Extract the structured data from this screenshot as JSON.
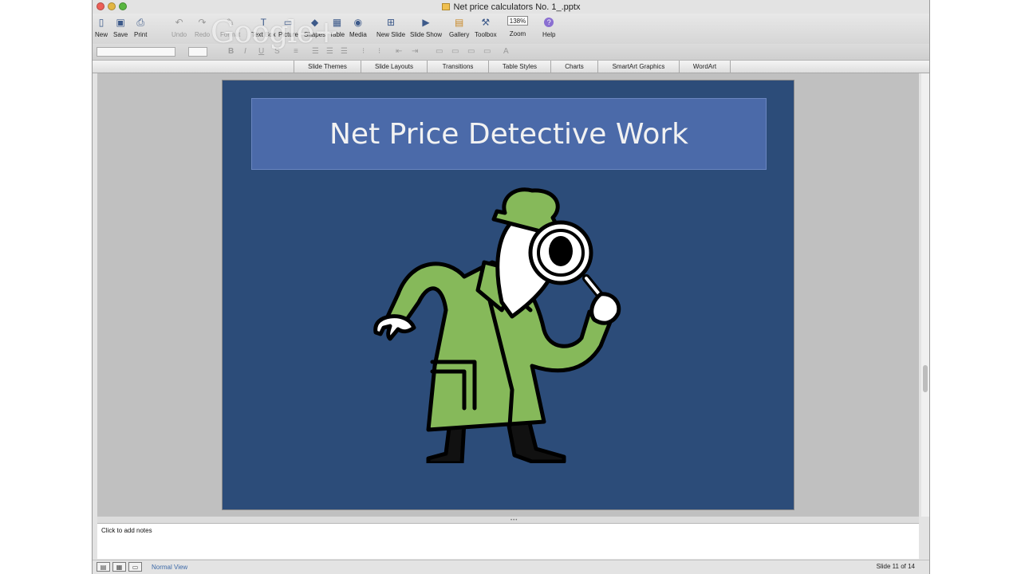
{
  "window": {
    "title": "Net price calculators No. 1_.pptx"
  },
  "toolbar": {
    "items": [
      {
        "label": "New",
        "icon": "new-document-icon"
      },
      {
        "label": "Save",
        "icon": "save-icon"
      },
      {
        "label": "Print",
        "icon": "print-icon"
      },
      {
        "label": "Undo",
        "icon": "undo-icon"
      },
      {
        "label": "Redo",
        "icon": "redo-icon"
      },
      {
        "label": "Format",
        "icon": "format-brush-icon"
      },
      {
        "label": "Text Box",
        "icon": "text-box-icon"
      },
      {
        "label": "Picture",
        "icon": "picture-icon"
      },
      {
        "label": "Shapes",
        "icon": "shapes-icon"
      },
      {
        "label": "Table",
        "icon": "table-icon"
      },
      {
        "label": "Media",
        "icon": "media-icon"
      },
      {
        "label": "New Slide",
        "icon": "new-slide-icon"
      },
      {
        "label": "Slide Show",
        "icon": "slide-show-icon"
      },
      {
        "label": "Gallery",
        "icon": "gallery-icon"
      },
      {
        "label": "Toolbox",
        "icon": "toolbox-icon"
      }
    ],
    "zoom_value": "138%",
    "zoom_label": "Zoom",
    "help_label": "Help"
  },
  "watermark": {
    "text": "Google+"
  },
  "gallery_tabs": [
    "Slide Themes",
    "Slide Layouts",
    "Transitions",
    "Table Styles",
    "Charts",
    "SmartArt Graphics",
    "WordArt"
  ],
  "slide": {
    "title": "Net Price Detective Work"
  },
  "notes": {
    "placeholder": "Click to add notes"
  },
  "status": {
    "view_name": "Normal View",
    "slide_counter": "Slide 11 of 14"
  },
  "colors": {
    "slide_bg": "#2c4c79",
    "title_box": "#4b6aa9",
    "coat_green": "#86b95a"
  }
}
